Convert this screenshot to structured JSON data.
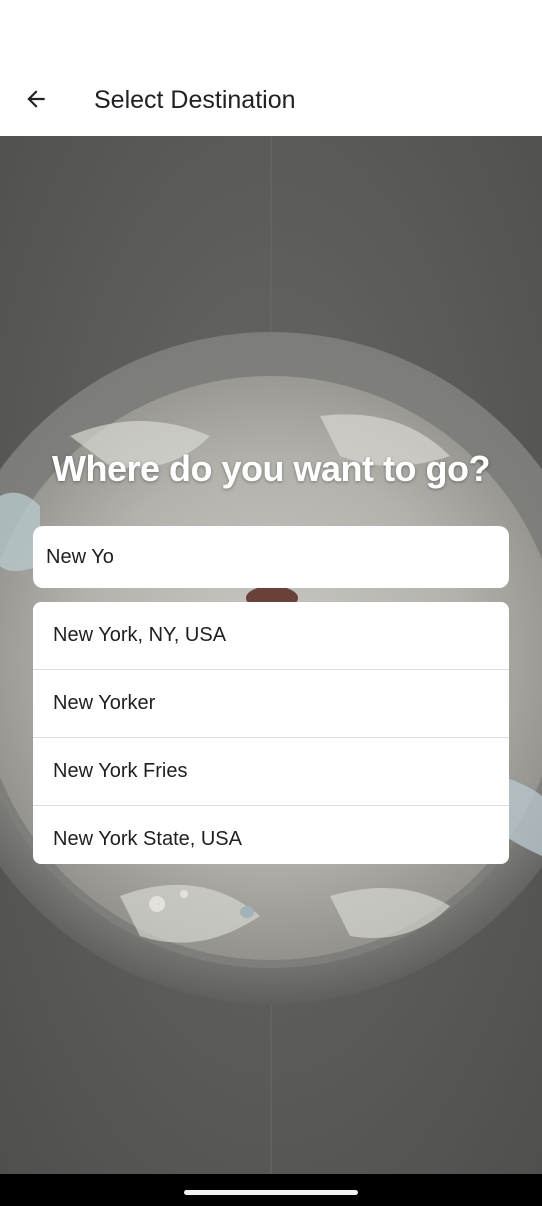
{
  "app_bar": {
    "title": "Select Destination",
    "back_icon": "arrow-left-icon"
  },
  "hero": {
    "headline": "Where do you want to go?"
  },
  "search": {
    "value": "New Yo"
  },
  "suggestions": [
    "New York, NY, USA",
    "New Yorker",
    "New York Fries",
    "New York State, USA"
  ],
  "colors": {
    "app_bar_bg": "#ffffff",
    "title_text": "#202124",
    "headline_text": "#ffffff",
    "backdrop": "#5d5d5b",
    "nav_bar": "#000000"
  }
}
